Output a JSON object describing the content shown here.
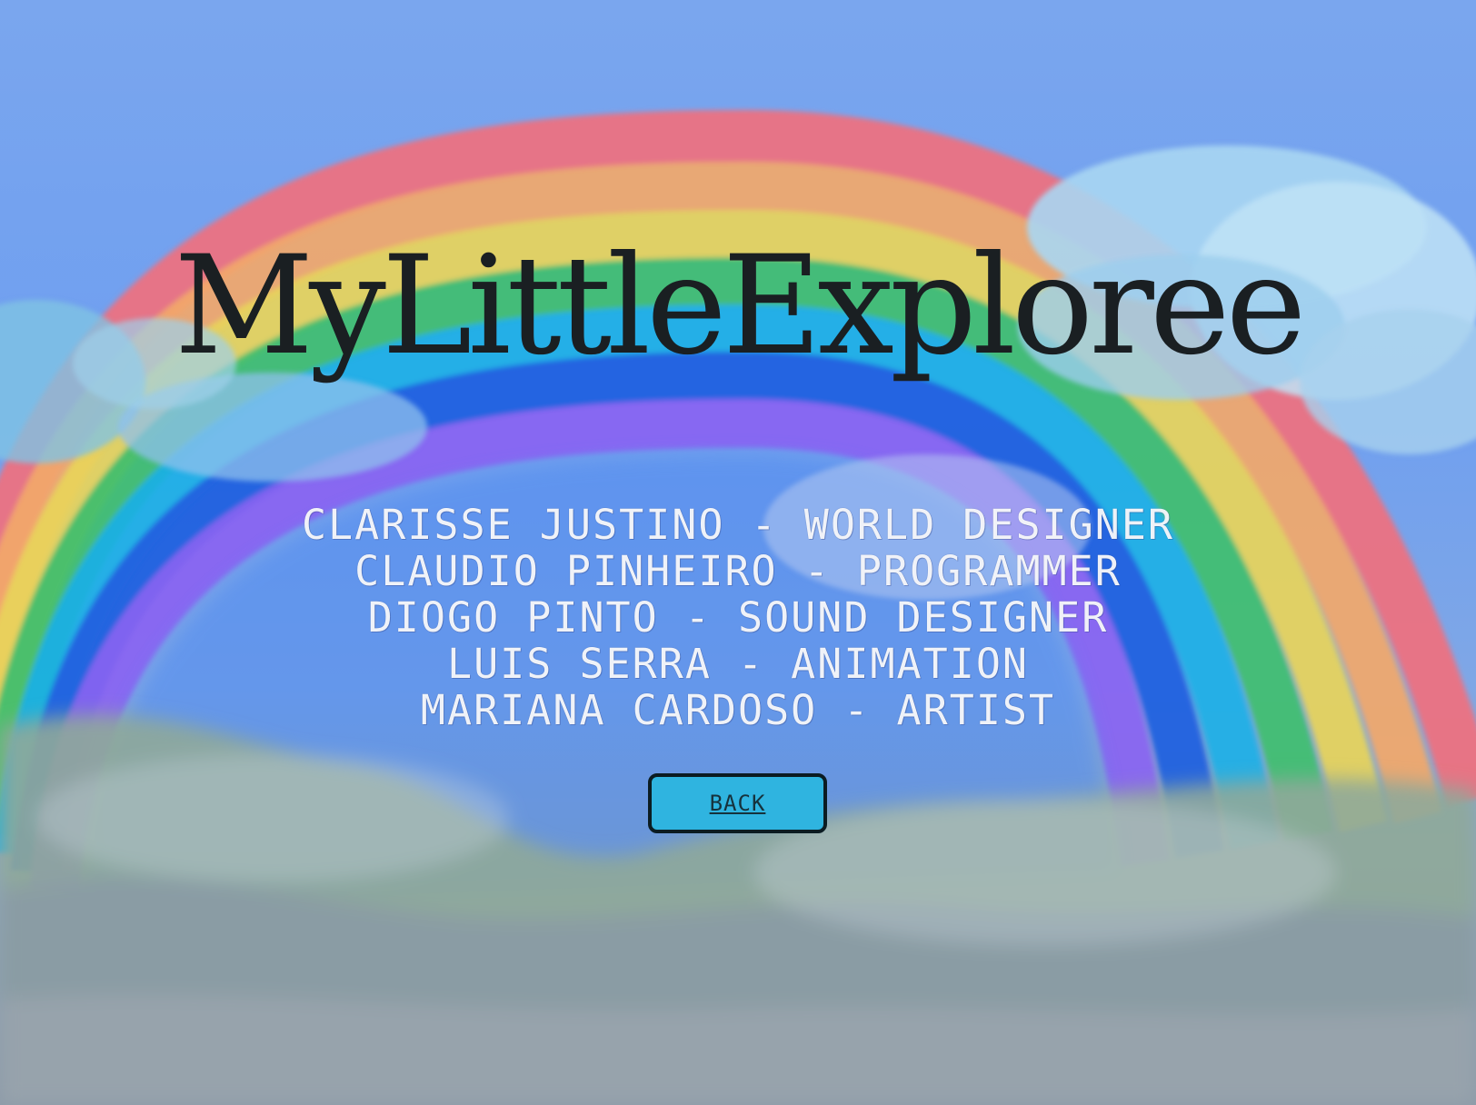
{
  "game": {
    "title": "MyLittleExploree",
    "credits": [
      "CLARISSE JUSTINO - WORLD DESIGNER",
      "CLAUDIO PINHEIRO - PROGRAMMER",
      "DIOGO PINTO - SOUND DESIGNER",
      "LUIS SERRA - ANIMATION",
      "MARIANA CARDOSO - ARTIST"
    ],
    "back_label": "BACK"
  },
  "colors": {
    "sky": "#7aa6ee",
    "rainbow": [
      "#f0707e",
      "#f2a86a",
      "#e8d45a",
      "#3fbf6f",
      "#1bb0e6",
      "#1f5fe0",
      "#8a63f2"
    ],
    "button_fill": "#2fb4e0",
    "button_border": "#0b1c22",
    "title": "#1a1f22",
    "credits_text": "#ffffff"
  }
}
